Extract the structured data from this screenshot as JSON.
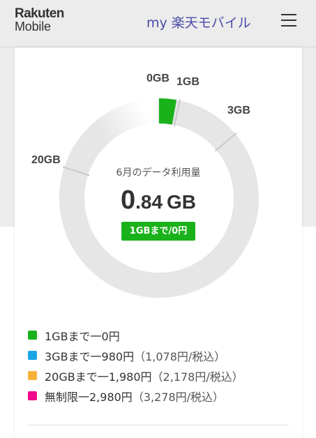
{
  "header": {
    "logo_line1": "Rakuten",
    "logo_line2": "Mobile",
    "title": "my 楽天モバイル",
    "menu_icon": "hamburger-menu-icon"
  },
  "usage": {
    "caption": "6月のデータ利用量",
    "value_int": "0",
    "value_rest": ".84",
    "unit": "GB",
    "badge": "1GBまで/0円",
    "ring_labels": {
      "gb0": "0GB",
      "gb1": "1GB",
      "gb3": "3GB",
      "gb20": "20GB"
    },
    "used_gb": 0.84,
    "used_color": "#1ab21a",
    "track_color": "#e6e6e6"
  },
  "legend": [
    {
      "label": "1GBまで一0円",
      "note": "",
      "color": "#1ab21a"
    },
    {
      "label": "3GBまで一980円",
      "note": "（1,078円/税込）",
      "color": "#1aa5e6"
    },
    {
      "label": "20GBまで一1,980円",
      "note": "（2,178円/税込）",
      "color": "#f7b23b"
    },
    {
      "label": "無制限一2,980円",
      "note": " （3,278円/税込）",
      "color": "#f0098a"
    }
  ]
}
